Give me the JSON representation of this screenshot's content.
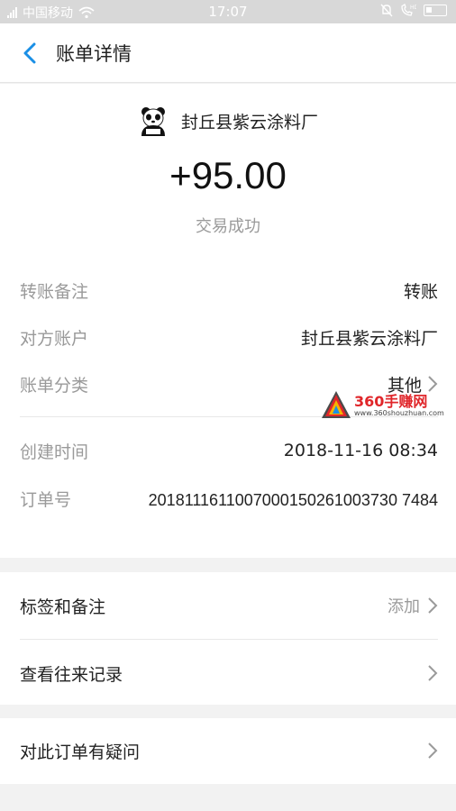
{
  "status_bar": {
    "carrier": "中国移动",
    "time": "17:07"
  },
  "nav": {
    "title": "账单详情"
  },
  "summary": {
    "merchant_name": "封丘县紫云涂料厂",
    "amount": "+95.00",
    "status": "交易成功"
  },
  "details": [
    {
      "label": "转账备注",
      "value": "转账"
    },
    {
      "label": "对方账户",
      "value": "封丘县紫云涂料厂"
    },
    {
      "label": "账单分类",
      "value": "其他"
    },
    {
      "label": "创建时间",
      "value": "2018-11-16 08:34"
    },
    {
      "label": "订单号",
      "value": "2018111611007000150261003730 7484"
    }
  ],
  "watermark": {
    "title": "360手赚网",
    "url": "www.360shouzhuan.com"
  },
  "menu": {
    "tags_label": "标签和备注",
    "tags_action": "添加",
    "history_label": "查看往来记录",
    "question_label": "对此订单有疑问"
  },
  "colors": {
    "accent": "#1a8fe6",
    "muted": "#9a9a9a",
    "watermark_red": "#e0262a"
  },
  "icons": [
    "signal-icon",
    "wifi-icon",
    "mute-icon",
    "hd-call-icon",
    "battery-icon",
    "back-arrow-icon",
    "panda-avatar-icon",
    "chevron-right-icon",
    "watermark-logo-icon"
  ]
}
